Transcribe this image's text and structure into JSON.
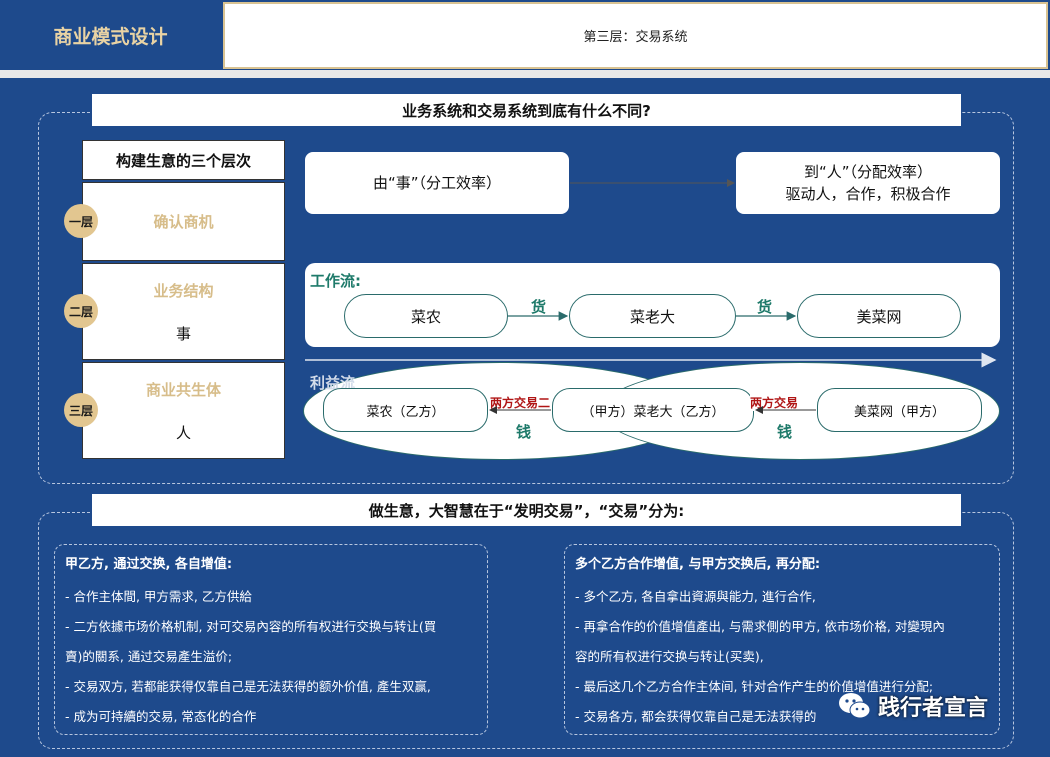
{
  "header": {
    "left_title": "商业模式设计",
    "subtitle": "第三层：交易系统"
  },
  "banner_top": "业务系统和交易系统到底有什么不同?",
  "levels": {
    "header": "构建生意的三个层次",
    "items": [
      {
        "badge": "一层",
        "title": "确认商机",
        "body": ""
      },
      {
        "badge": "二层",
        "title": "业务结构",
        "body": "事"
      },
      {
        "badge": "三层",
        "title": "商业共生体",
        "body": "人"
      }
    ]
  },
  "top_flow": {
    "left": "由“事”（分工效率）",
    "right_line1": "到“人”（分配效率）",
    "right_line2": "驱动人，合作，积极合作"
  },
  "workflow": {
    "label": "工作流:",
    "nodes": [
      "菜农",
      "菜老大",
      "美菜网"
    ],
    "arrow_label": "货"
  },
  "benefit_flow": {
    "label": "利益流",
    "nodes": [
      "菜农（乙方）",
      "（甲方）菜老大（乙方）",
      "美菜网（甲方）"
    ],
    "trade_label": "两方交易",
    "trade_label_left": "两方交易二",
    "money_label": "钱"
  },
  "banner_bottom": "做生意，大智慧在于“发明交易”，“交易”分为:",
  "info_left": {
    "title": "甲乙方, 通过交换, 各自增值:",
    "lines": [
      "- 合作主体間, 甲方需求, 乙方供給",
      "- 二方依據市场价格机制, 对可交易內容的所有权进行交换与转让(買",
      "賣)的關系, 通过交易產生溢价;",
      "- 交易双方, 若都能获得仅靠自己是无法获得的额外价值, 產生双赢,",
      "- 成为可持續的交易, 常态化的合作"
    ]
  },
  "info_right": {
    "title": "多个乙方合作增值, 与甲方交换后, 再分配:",
    "lines": [
      "- 多个乙方, 各自拿出資源與能力, 進行合作,",
      "- 再拿合作的价值增值產出, 与需求側的甲方, 依市场价格, 对變現內",
      "容的所有权进行交换与转让(买卖),",
      "- 最后这几个乙方合作主体间, 针对合作产生的价值增值进行分配;",
      "- 交易各方, 都会获得仅靠自己是无法获得的"
    ]
  },
  "watermark": "践行者宣言",
  "colors": {
    "background": "#1e4a8c",
    "accent_gold": "#d7bd8a",
    "flow_green": "#1e7a6a",
    "trade_red": "#b01515"
  }
}
